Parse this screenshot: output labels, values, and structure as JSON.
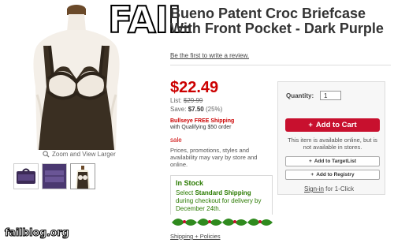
{
  "product": {
    "title": "Bueno Patent Croc Briefcase With Front Pocket - Dark Purple",
    "review_link": "Be the first to write a review.",
    "price": "$22.49",
    "list_label": "List:",
    "list_price": "$29.99",
    "save_label": "Save:",
    "save_amount": "$7.50",
    "save_pct": "(25%)",
    "bullseye_line1": "Bullseye FREE Shipping",
    "bullseye_line2": "with Qualifying $50 order",
    "sale": "sale",
    "price_note": "Prices, promotions, styles and availability may vary by store and online."
  },
  "stock": {
    "heading": "In Stock",
    "text_pre": "Select",
    "text_bold": "Standard Shipping",
    "text_post": "during checkout for delivery by December 24th."
  },
  "links": {
    "shipping": "Shipping + Policies",
    "zoom": "Zoom and View Larger"
  },
  "buybox": {
    "qty_label": "Quantity:",
    "qty_value": "1",
    "add_to_cart": "Add to Cart",
    "availability": "This item is available online, but is not available in stores.",
    "add_target_list": "Add to TargetList",
    "add_registry": "Add to Registry",
    "sign_in": "Sign-in",
    "sign_in_suffix": "for 1-Click"
  },
  "overlay": {
    "fail": "FAIL",
    "watermark": "failblog.org"
  },
  "colors": {
    "price_red": "#cc0000",
    "cart_red": "#c8102e",
    "stock_green": "#2a7a00"
  },
  "icons": [
    "magnifier-icon",
    "plus-icon",
    "holly-icon"
  ]
}
